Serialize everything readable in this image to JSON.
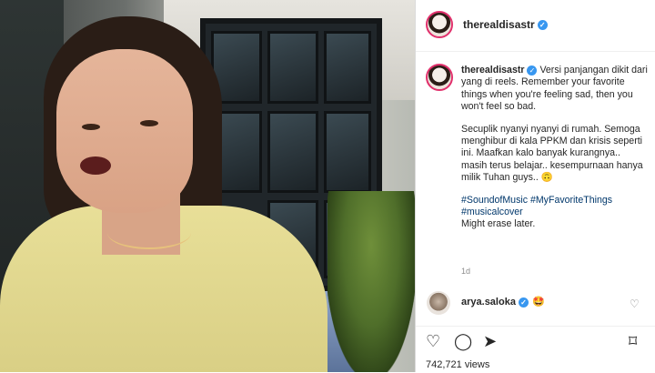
{
  "media": {
    "description_icon": "video-frame"
  },
  "header": {
    "username": "therealdisastr",
    "verified_icon": "verified-badge-icon"
  },
  "caption": {
    "username": "therealdisastr",
    "lines": [
      "Versi panjangan dikit dari yang di reels. Remember your favorite things when you're feeling sad, then you won't feel so bad.",
      "Secuplik nyanyi nyanyi di rumah. Semoga menghibur di kala PPKM dan krisis seperti ini. Maafkan kalo banyak kurangnya.. masih terus belajar.. kesempurnaan hanya milik Tuhan guys.."
    ],
    "emoji": "🙃",
    "hashtags": "#SoundofMusic #MyFavoriteThings #musicalcover",
    "tail": "Might erase later."
  },
  "time": "1d",
  "comment": {
    "username": "arya.saloka",
    "emoji": "🤩"
  },
  "actions": {
    "like": "♡",
    "comment": "◯",
    "share": "➤",
    "save": "⌑"
  },
  "views": "742,721 views",
  "colors": {
    "accent": "#3897f0",
    "link": "#00376b",
    "story_ring": "#e1306c"
  }
}
